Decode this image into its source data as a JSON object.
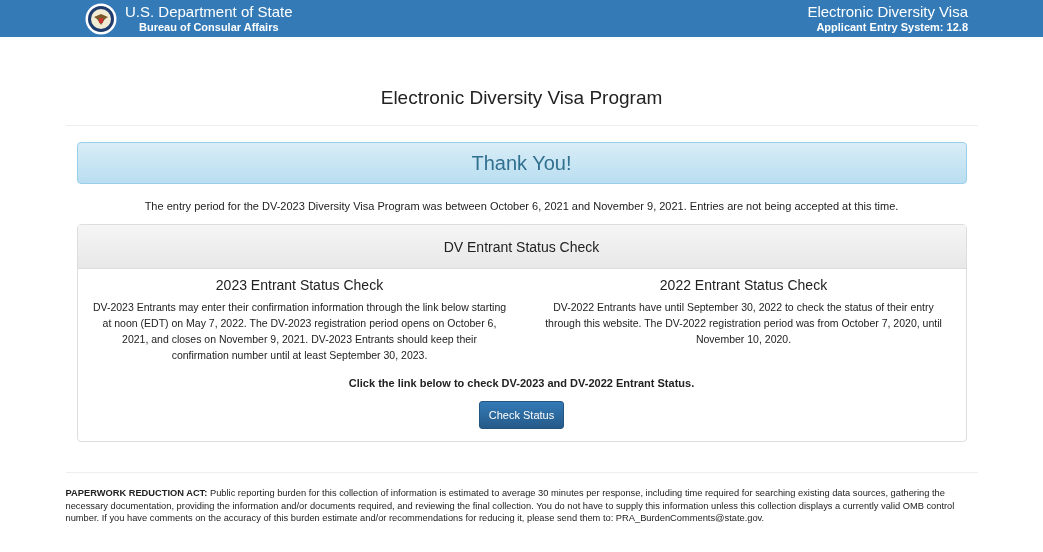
{
  "header": {
    "agency": "U.S. Department of State",
    "bureau": "Bureau of Consular Affairs",
    "program": "Electronic Diversity Visa",
    "system": "Applicant Entry System: 12.8"
  },
  "page_title": "Electronic Diversity Visa Program",
  "alert": "Thank You!",
  "notice": "The entry period for the DV-2023 Diversity Visa Program was between October 6, 2021 and November 9, 2021. Entries are not being accepted at this time.",
  "status_panel": {
    "title": "DV Entrant Status Check",
    "columns": [
      {
        "heading": "2023 Entrant Status Check",
        "text": "DV-2023 Entrants may enter their confirmation information through the link below starting at noon (EDT) on May 7, 2022. The DV-2023 registration period opens on October 6, 2021, and closes on November 9, 2021. DV-2023 Entrants should keep their confirmation number until at least September 30, 2023."
      },
      {
        "heading": "2022 Entrant Status Check",
        "text": "DV-2022 Entrants have until September 30, 2022 to check the status of their entry through this website. The DV-2022 registration period was from October 7, 2020, until November 10, 2020."
      }
    ],
    "instruction": "Click the link below to check DV-2023 and DV-2022 Entrant Status.",
    "button": "Check Status"
  },
  "footer": "**PAPERWORK REDUCTION ACT:** Public reporting burden for this collection of information is estimated to average 30 minutes per response, including time required for searching existing data sources, gathering the necessary documentation, providing the information and/or documents required, and reviewing the final collection. You do not have to supply this information unless this collection displays a currently valid OMB control number. If you have comments on the accuracy of this burden estimate and/or recommendations for reducing it, please send them to: PRA_BurdenComments@state.gov."
}
